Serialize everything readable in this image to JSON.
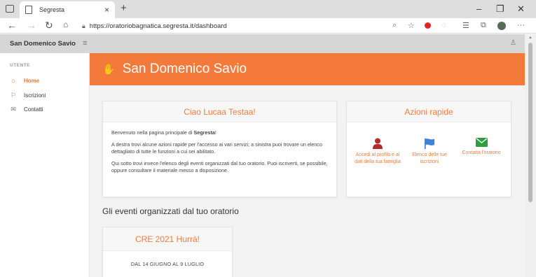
{
  "browser": {
    "tab_title": "Segresta",
    "tab_close": "×",
    "new_tab": "+",
    "url": "https://oratoriobagnatica.segresta.it/dashboard",
    "window_controls": [
      "–",
      "❐",
      "✕"
    ]
  },
  "app": {
    "brand": "San Domenico Savio",
    "hamburger": "≡",
    "user_icon": "♙"
  },
  "sidebar": {
    "section": "UTENTE",
    "items": [
      {
        "icon": "⌂",
        "label": "Home",
        "active": true
      },
      {
        "icon": "⚐",
        "label": "Iscrizioni",
        "active": false
      },
      {
        "icon": "✉",
        "label": "Contatti",
        "active": false
      }
    ]
  },
  "hero": {
    "icon": "✋",
    "title": "San Domenico Savio"
  },
  "welcome": {
    "title": "Ciao Lucaa Testaa!",
    "p1_pre": "Benvenuto nella pagina principale di ",
    "p1_bold": "Segresta",
    "p1_post": "!",
    "p2": "A destra trovi alcune azioni rapide per l'accesso ai vari servizi; a sinistra puoi trovare un elenco dettagliato di tutte le funzioni a cui sei abilitato.",
    "p3": "Qui sotto trovi invece l'elenco degli eventi organizzati dal tuo oratorio. Puoi iscriverti, se possibile, oppure consultare il materiale messo a disposizione."
  },
  "quick_actions": {
    "title": "Azioni rapide",
    "items": [
      {
        "label": "Accedi al profilo e ai dati della tua famiglia",
        "icon": "user-icon",
        "color": "#b52b2b"
      },
      {
        "label": "Elenco delle tue iscrizioni",
        "icon": "flag-icon",
        "color": "#3d82d6"
      },
      {
        "label": "Contatta l'oratorio",
        "icon": "envelope-icon",
        "color": "#2e9e43"
      }
    ]
  },
  "events": {
    "section_title": "Gli eventi organizzati dal tuo oratorio",
    "items": [
      {
        "title": "CRE 2021 Hurrà!",
        "date": "DAL 14 GIUGNO AL 9 LUGLIO"
      }
    ]
  },
  "colors": {
    "accent": "#f47a3c"
  }
}
